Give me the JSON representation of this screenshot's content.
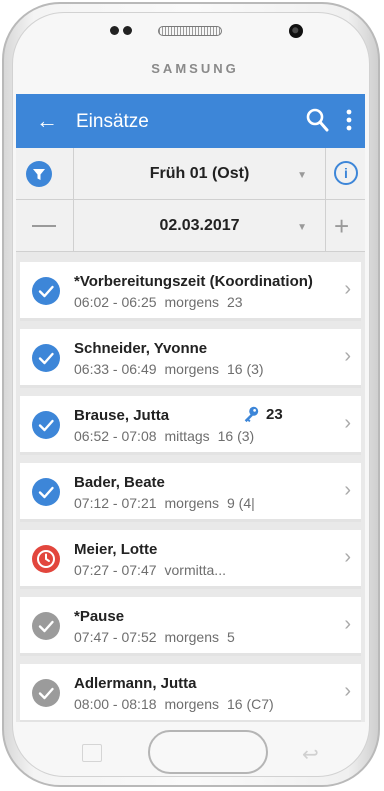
{
  "device": {
    "brand": "SAMSUNG"
  },
  "appbar": {
    "title": "Einsätze",
    "back_icon": "arrow-left-icon",
    "search_icon": "search-icon",
    "more_icon": "more-vert-icon"
  },
  "filter": {
    "selected": "Früh 01 (Ost)",
    "info_icon": "info-icon",
    "filter_icon": "filter-icon"
  },
  "date": {
    "selected": "02.03.2017"
  },
  "colors": {
    "primary": "#3d86d8",
    "late": "#e2463d",
    "gray": "#9b9b9b"
  },
  "items": [
    {
      "name": "*Vorbereitungszeit (Koordination)",
      "time": "06:02 - 06:25",
      "period": "morgens",
      "count": "23",
      "status": "done"
    },
    {
      "name": "Schneider, Yvonne",
      "time": "06:33 - 06:49",
      "period": "morgens",
      "count": "16 (3)",
      "status": "done"
    },
    {
      "name": "Brause, Jutta",
      "time": "06:52 - 07:08",
      "period": "mittags",
      "count": "16 (3)",
      "key_number": "23",
      "status": "done"
    },
    {
      "name": "Bader, Beate",
      "time": "07:12 - 07:21",
      "period": "morgens",
      "count": "9 (4|",
      "status": "done"
    },
    {
      "name": "Meier, Lotte",
      "time": "07:27 - 07:47",
      "period": "vormitta...",
      "count": "",
      "status": "late"
    },
    {
      "name": "*Pause",
      "time": "07:47 - 07:52",
      "period": "morgens",
      "count": "5",
      "status": "gray"
    },
    {
      "name": "Adlermann, Jutta",
      "time": "08:00 - 08:18",
      "period": "morgens",
      "count": "16 (C7)",
      "status": "gray"
    }
  ]
}
